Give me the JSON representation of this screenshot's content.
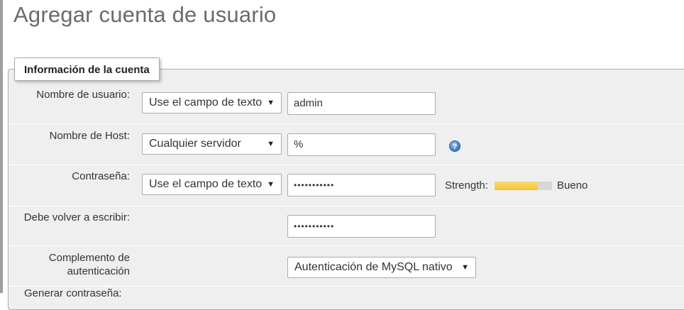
{
  "page": {
    "title": "Agregar cuenta de usuario"
  },
  "fieldset": {
    "legend": "Información de la cuenta"
  },
  "username": {
    "label": "Nombre de usuario:",
    "select_value": "Use el campo de texto",
    "input_value": "admin"
  },
  "host": {
    "label": "Nombre de Host:",
    "select_value": "Cualquier servidor",
    "input_value": "%"
  },
  "password": {
    "label": "Contraseña:",
    "select_value": "Use el campo de texto",
    "masked_value": "•••••••••••",
    "strength_label": "Strength:",
    "strength_text": "Bueno",
    "strength_level": 0.75
  },
  "retype": {
    "label": "Debe volver a escribir:",
    "masked_value": "•••••••••••"
  },
  "auth_plugin": {
    "label_line1": "Complemento de",
    "label_line2": "autenticación",
    "select_value": "Autenticación de MySQL nativo"
  },
  "next_row": {
    "label": "Generar contraseña:"
  },
  "icons": {
    "help": "help-icon",
    "dropdown": "triangle-down-icon"
  },
  "colors": {
    "meter_fill": "#f3c43a",
    "meter_track": "#d7d7d7",
    "help_icon": "#4a86c8"
  }
}
